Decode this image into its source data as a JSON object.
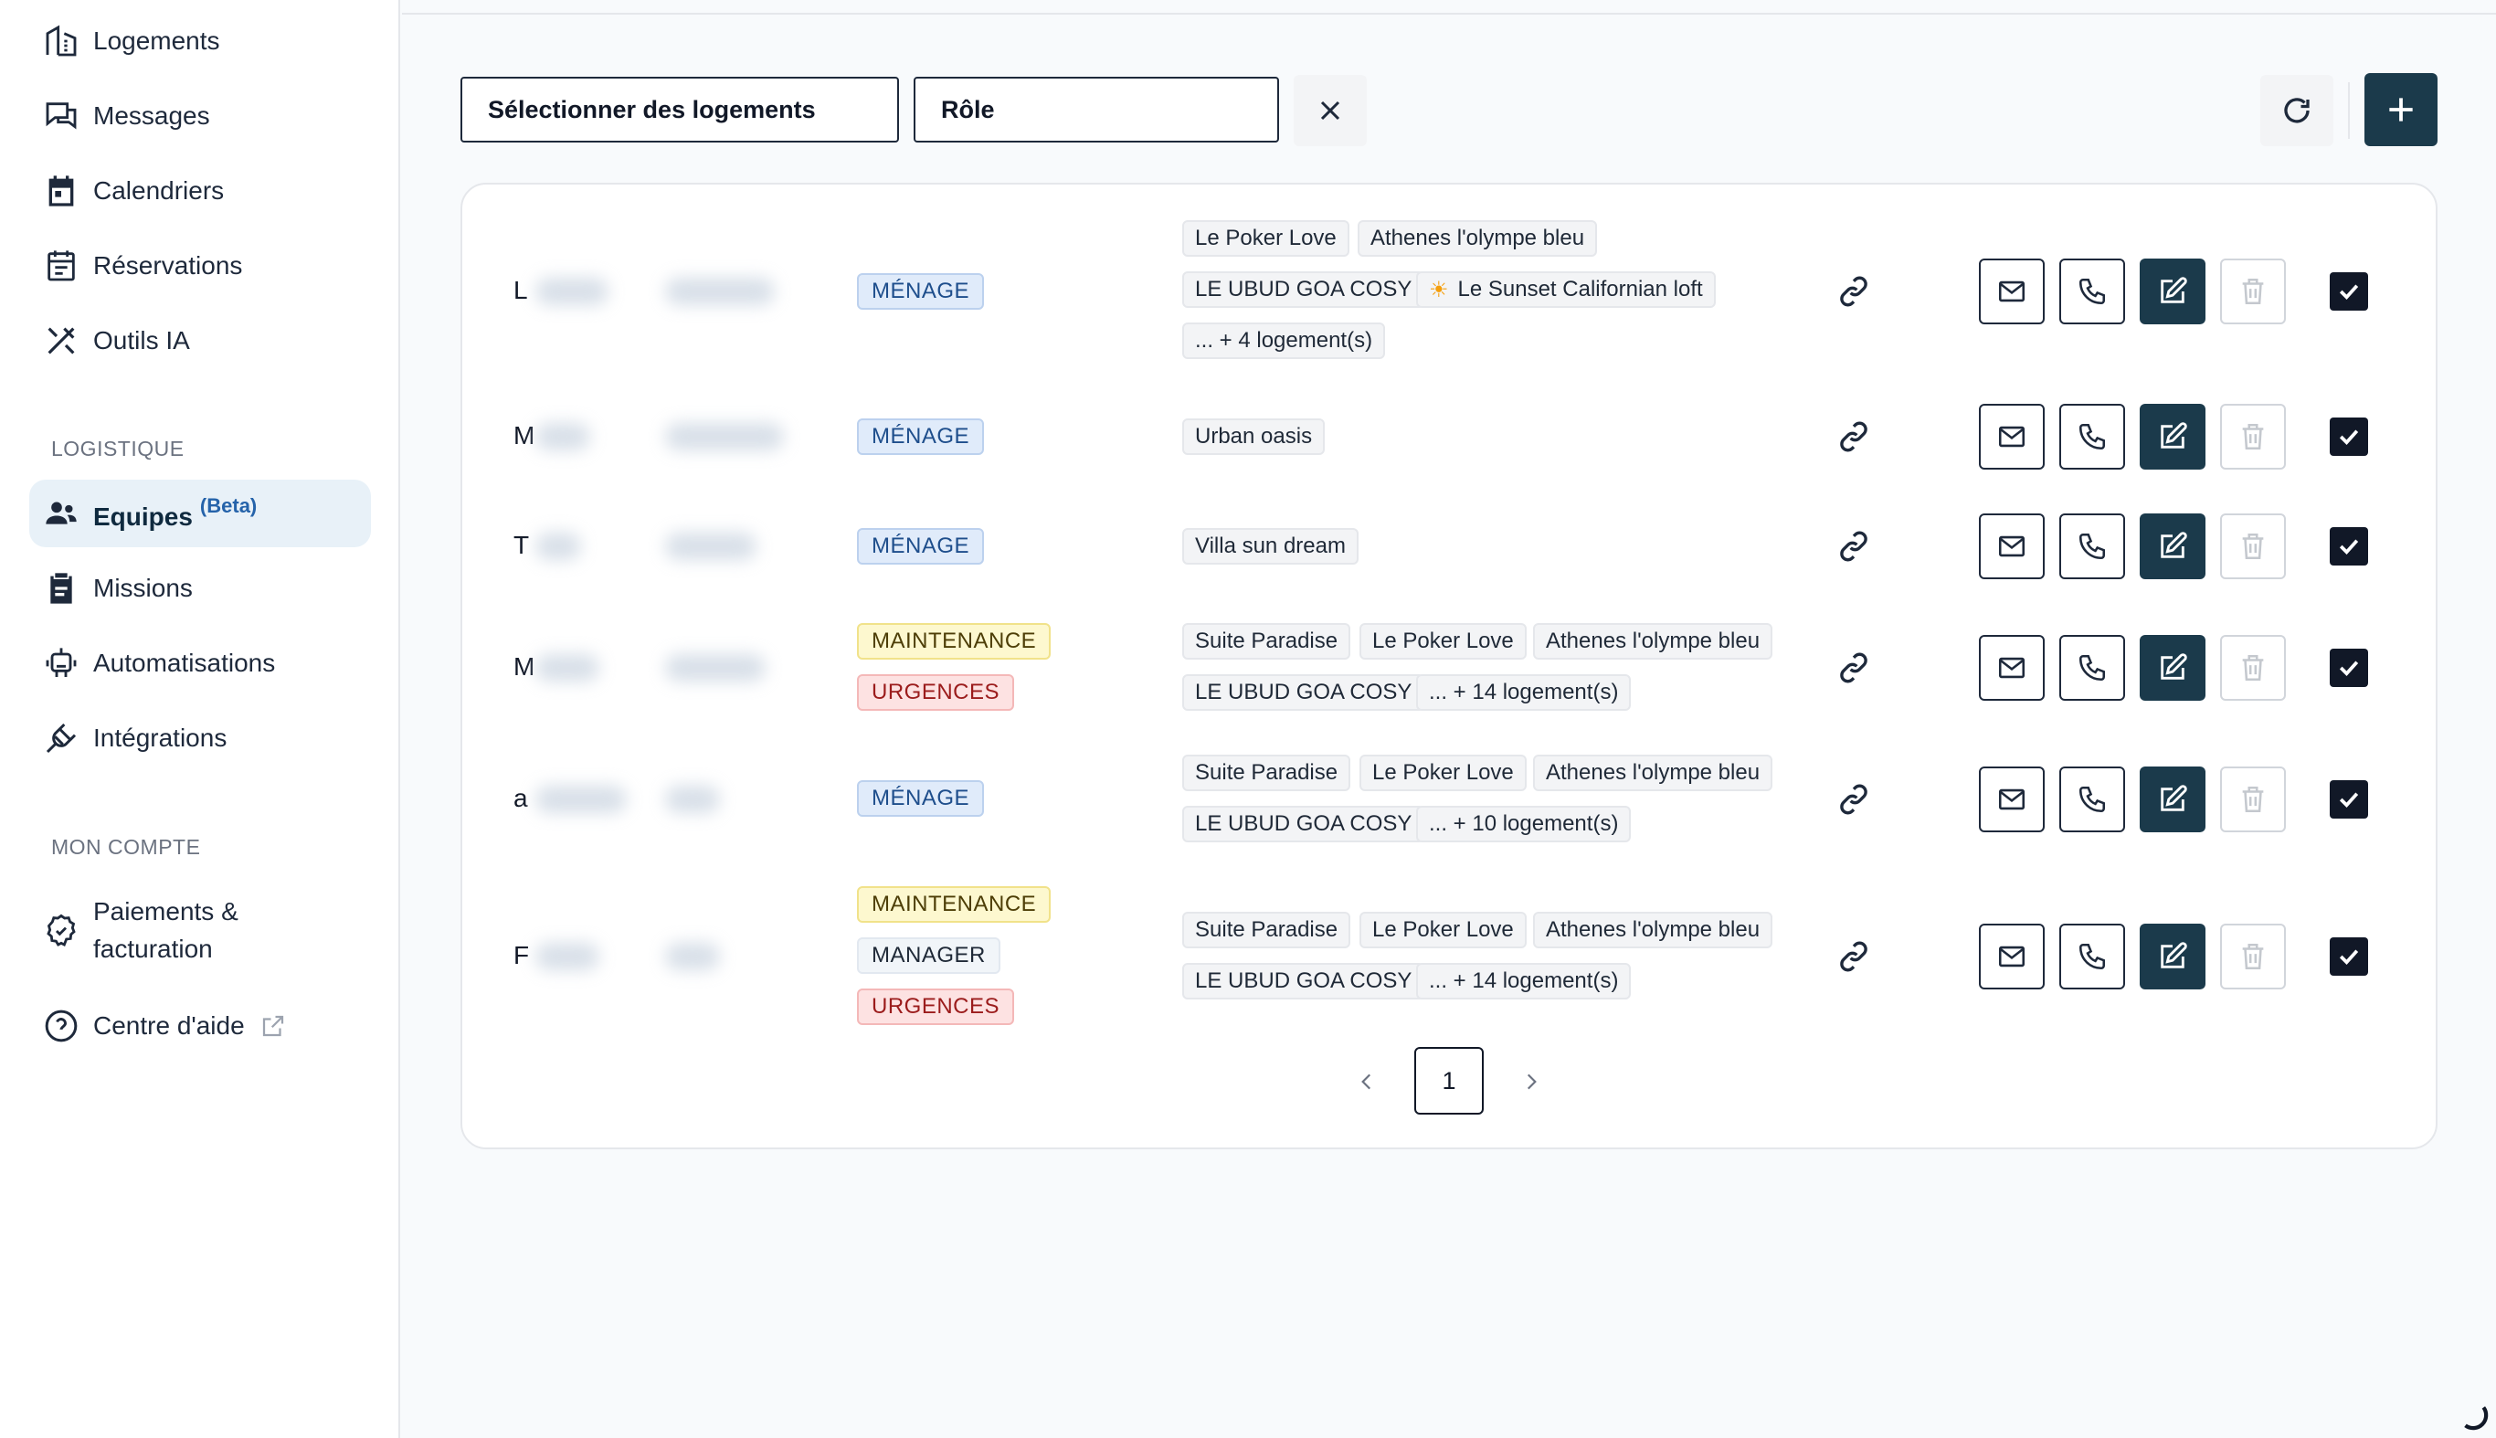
{
  "sidebar": {
    "items": [
      {
        "label": "Logements",
        "icon": "buildings-icon"
      },
      {
        "label": "Messages",
        "icon": "chat-icon"
      },
      {
        "label": "Calendriers",
        "icon": "calendar-icon"
      },
      {
        "label": "Réservations",
        "icon": "reservations-icon"
      },
      {
        "label": "Outils IA",
        "icon": "tools-icon"
      }
    ],
    "section_logistique": "LOGISTIQUE",
    "logistique_items": [
      {
        "label": "Equipes",
        "badge": "(Beta)",
        "icon": "team-icon",
        "active": true
      },
      {
        "label": "Missions",
        "icon": "clipboard-icon"
      },
      {
        "label": "Automatisations",
        "icon": "robot-icon"
      },
      {
        "label": "Intégrations",
        "icon": "plug-icon"
      }
    ],
    "section_compte": "MON COMPTE",
    "compte_items": [
      {
        "label_line1": "Paiements &",
        "label_line2": "facturation",
        "icon": "billing-icon"
      },
      {
        "label": "Centre d'aide",
        "icon": "help-icon",
        "external": true
      }
    ]
  },
  "filters": {
    "logements_placeholder": "Sélectionner des logements",
    "role_placeholder": "Rôle"
  },
  "colors": {
    "primary": "#1b3a4b",
    "menage": "#e0ebfa",
    "maintenance": "#fdf8cf",
    "urgences": "#fde2e2"
  },
  "rows": [
    {
      "name_initial": "L",
      "roles": [
        {
          "label": "MÉNAGE",
          "type": "menage"
        }
      ],
      "logements": [
        "Le Poker Love",
        "Athenes l'olympe bleu",
        "LE UBUD GOA COSY",
        "Le Sunset Californian loft",
        "... + 4 logement(s)"
      ]
    },
    {
      "name_initial": "M",
      "roles": [
        {
          "label": "MÉNAGE",
          "type": "menage"
        }
      ],
      "logements": [
        "Urban oasis"
      ]
    },
    {
      "name_initial": "T",
      "roles": [
        {
          "label": "MÉNAGE",
          "type": "menage"
        }
      ],
      "logements": [
        "Villa sun dream"
      ]
    },
    {
      "name_initial": "M",
      "roles": [
        {
          "label": "MAINTENANCE",
          "type": "maintenance"
        },
        {
          "label": "URGENCES",
          "type": "urgences"
        }
      ],
      "logements": [
        "Suite Paradise",
        "Le Poker Love",
        "Athenes l'olympe bleu",
        "LE UBUD GOA COSY",
        "... + 14 logement(s)"
      ]
    },
    {
      "name_initial": "a",
      "roles": [
        {
          "label": "MÉNAGE",
          "type": "menage"
        }
      ],
      "logements": [
        "Suite Paradise",
        "Le Poker Love",
        "Athenes l'olympe bleu",
        "LE UBUD GOA COSY",
        "... + 10 logement(s)"
      ]
    },
    {
      "name_initial": "F",
      "roles": [
        {
          "label": "MAINTENANCE",
          "type": "maintenance"
        },
        {
          "label": "MANAGER",
          "type": "manager"
        },
        {
          "label": "URGENCES",
          "type": "urgences"
        }
      ],
      "logements": [
        "Suite Paradise",
        "Le Poker Love",
        "Athenes l'olympe bleu",
        "LE UBUD GOA COSY",
        "... + 14 logement(s)"
      ]
    }
  ],
  "pagination": {
    "current": "1"
  }
}
